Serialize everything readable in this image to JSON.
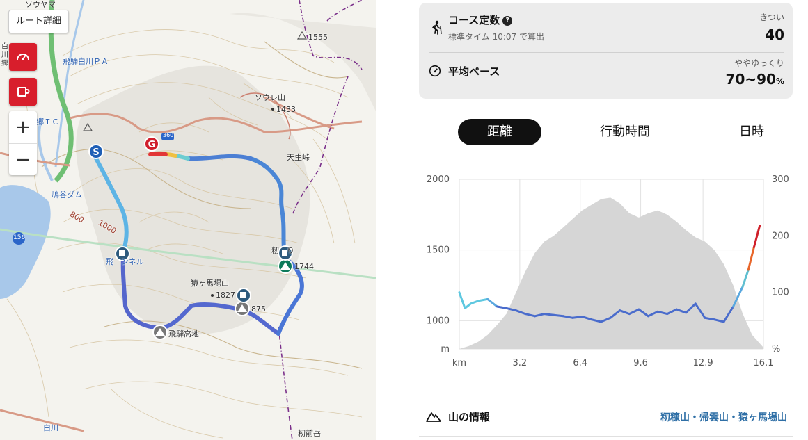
{
  "map": {
    "route_detail_button": "ルート詳細",
    "zoom_in": "+",
    "zoom_out": "−",
    "labels": {
      "soyu_top": "ソウヤマ",
      "hida_shirakawa_pa": "飛騨白川ＰＡ",
      "ic": "郷ＩＣ",
      "hatogaya_dam": "鳩谷ダム",
      "soyu_yama": "ソウレ山",
      "soyu_elev": "1433",
      "tenseitoge": "天生峠",
      "peak_1555": "1555",
      "tunnel": "飛　ンネル",
      "momoka_label": "籾　り",
      "elev_1744": "1744",
      "sarugababa": "猿ヶ馬場山",
      "elev_1827": "1827",
      "elev_1875": "875",
      "hida_kochi": "飛騨高地",
      "contour_800": "800",
      "contour_1000": "1000",
      "route_156": "156",
      "route_360": "360",
      "shirakawa": "白川",
      "kamimae": "籾前岳",
      "vertical_left": "白川郷"
    }
  },
  "course": {
    "title": "コース定数",
    "help_icon": "?",
    "subtitle": "標準タイム 10:07 で算出",
    "difficulty_caption": "きつい",
    "value": "40"
  },
  "pace": {
    "title": "平均ペース",
    "caption": "ややゆっくり",
    "value": "70~90",
    "unit": "%"
  },
  "tabs": [
    {
      "label": "距離",
      "active": true
    },
    {
      "label": "行動時間",
      "active": false
    },
    {
      "label": "日時",
      "active": false
    }
  ],
  "chart_data": {
    "type": "area",
    "x_unit_label": "km",
    "x_ticks": [
      "3.2",
      "6.4",
      "9.6",
      "12.9",
      "16.1"
    ],
    "xlim": [
      0,
      16.1
    ],
    "left_axis": {
      "unit_label": "m",
      "ticks": [
        "2000",
        "1500",
        "1000"
      ],
      "ylim": [
        800,
        2000
      ]
    },
    "right_axis": {
      "unit_label": "%",
      "ticks": [
        "300",
        "200",
        "100"
      ],
      "ylim": [
        0,
        300
      ]
    },
    "elevation_series": {
      "x": [
        0,
        0.5,
        1.0,
        1.5,
        2.0,
        2.5,
        3.0,
        3.5,
        4.0,
        4.5,
        5.0,
        5.5,
        6.0,
        6.5,
        7.0,
        7.5,
        8.0,
        8.5,
        9.0,
        9.5,
        10.0,
        10.5,
        11.0,
        11.5,
        12.0,
        12.5,
        13.0,
        13.5,
        14.0,
        14.5,
        15.0,
        15.5,
        16.1
      ],
      "y": [
        800,
        820,
        850,
        900,
        970,
        1050,
        1200,
        1350,
        1480,
        1560,
        1600,
        1660,
        1720,
        1780,
        1820,
        1860,
        1870,
        1830,
        1760,
        1730,
        1760,
        1780,
        1750,
        1700,
        1640,
        1590,
        1560,
        1500,
        1400,
        1250,
        1050,
        900,
        810
      ]
    },
    "pace_series": {
      "x": [
        0,
        0.3,
        0.6,
        1.0,
        1.5,
        2.0,
        2.5,
        3.0,
        3.5,
        4.0,
        4.5,
        5.0,
        5.5,
        6.0,
        6.5,
        7.0,
        7.5,
        8.0,
        8.5,
        9.0,
        9.5,
        10.0,
        10.5,
        11.0,
        11.5,
        12.0,
        12.5,
        13.0,
        13.5,
        14.0,
        14.5,
        15.0,
        15.3,
        15.6,
        15.9
      ],
      "y": [
        100,
        72,
        80,
        85,
        88,
        75,
        72,
        68,
        62,
        58,
        62,
        60,
        58,
        55,
        57,
        52,
        48,
        55,
        68,
        62,
        70,
        58,
        66,
        62,
        70,
        64,
        80,
        55,
        52,
        48,
        75,
        110,
        140,
        180,
        218
      ]
    }
  },
  "mountain": {
    "title": "山の情報",
    "list": "籾糠山・帰雲山・猿ヶ馬場山"
  }
}
